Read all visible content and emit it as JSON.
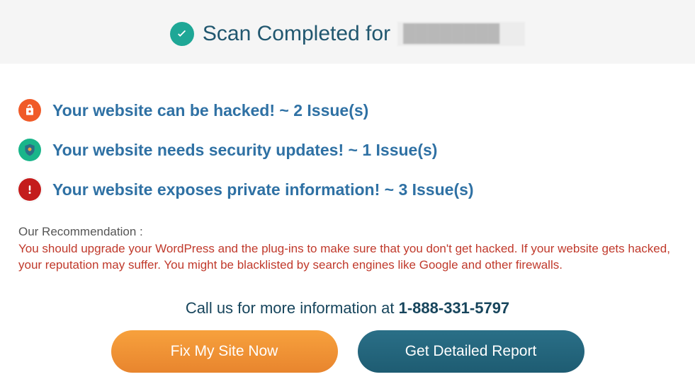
{
  "header": {
    "scan_completed_text": "Scan Completed for",
    "site_redacted": "████████"
  },
  "issues": [
    {
      "icon": "unlock-icon",
      "text": "Your website can be hacked! ~ 2 Issue(s)"
    },
    {
      "icon": "shield-icon",
      "text": "Your website needs security updates! ~ 1 Issue(s)"
    },
    {
      "icon": "alert-icon",
      "text": "Your website exposes private information! ~ 3 Issue(s)"
    }
  ],
  "recommendation": {
    "label": "Our Recommendation :",
    "text": "You should upgrade your WordPress and the plug-ins to make sure that you don't get hacked. If your website gets hacked, your reputation may suffer. You might be blacklisted by search engines like Google and other firewalls."
  },
  "call": {
    "prefix": "Call us for more information at ",
    "phone": "1-888-331-5797"
  },
  "buttons": {
    "fix_label": "Fix My Site Now",
    "report_label": "Get Detailed Report"
  }
}
